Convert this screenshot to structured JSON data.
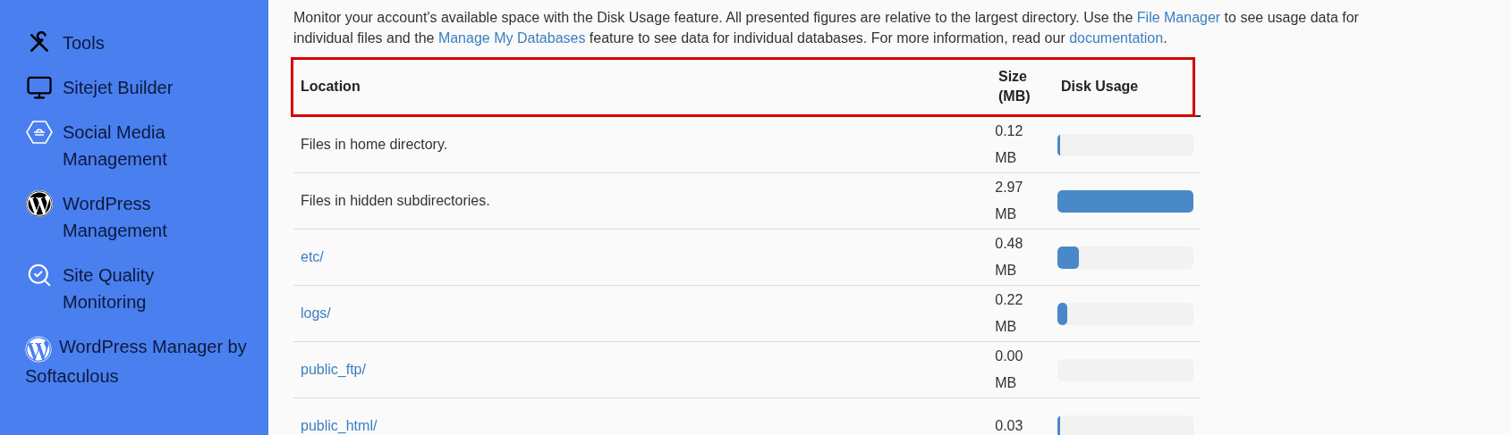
{
  "sidebar": {
    "items": [
      {
        "label": "Tools",
        "kind": "single"
      },
      {
        "label": "Sitejet Builder",
        "kind": "single"
      },
      {
        "label": "Social Media Management",
        "kind": "block"
      },
      {
        "label": "WordPress Management",
        "kind": "block"
      },
      {
        "label": "Site Quality Monitoring",
        "kind": "block"
      },
      {
        "label": "WordPress Manager by Softaculous",
        "kind": "inline"
      }
    ]
  },
  "intro": [
    {
      "kind": "text",
      "text": "Monitor your account's available space with the Disk Usage feature. All presented figures are relative to the largest directory. Use the "
    },
    {
      "kind": "link",
      "text": "File Manager"
    },
    {
      "kind": "text",
      "text": " to see usage data for individual files and the "
    },
    {
      "kind": "link",
      "text": "Manage My Databases"
    },
    {
      "kind": "text",
      "text": " feature to see data for individual databases. For more information, read our "
    },
    {
      "kind": "link",
      "text": "documentation"
    },
    {
      "kind": "text",
      "text": "."
    }
  ],
  "table": {
    "highlighted": true,
    "columns": [
      "Location",
      "Size (MB)",
      "Disk Usage"
    ],
    "rows": [
      {
        "location": "Files in home directory.",
        "kind": "text",
        "size": "0.12 MB",
        "level": 0.02
      },
      {
        "location": "Files in hidden subdirectories.",
        "kind": "text",
        "size": "2.97 MB",
        "level": 1
      },
      {
        "location": "etc/",
        "kind": "link",
        "size": "0.48 MB",
        "level": 0.16
      },
      {
        "location": "logs/",
        "kind": "link",
        "size": "0.22 MB",
        "level": 0.07
      },
      {
        "location": "public_ftp/",
        "kind": "link",
        "size": "0.00 MB",
        "level": 0
      },
      {
        "location": "public_html/",
        "kind": "link",
        "size": "0.03",
        "level": 0.01
      }
    ]
  }
}
